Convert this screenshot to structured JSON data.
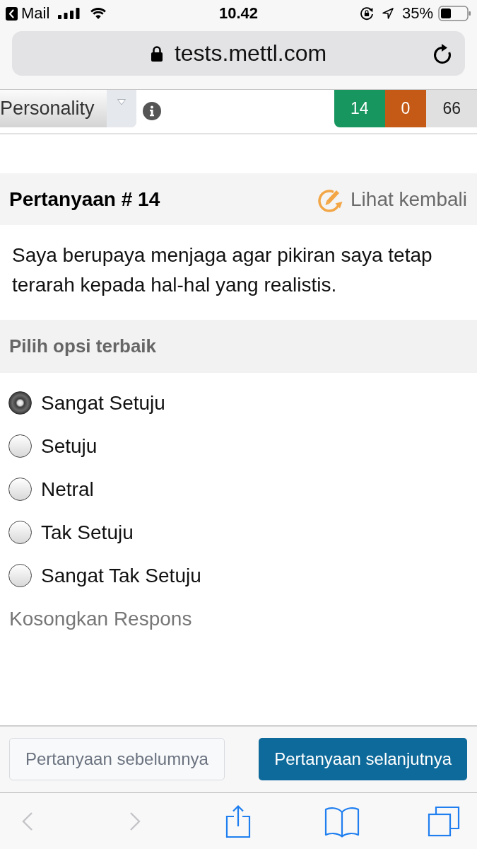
{
  "status_bar": {
    "back_app": "Mail",
    "time": "10.42",
    "battery_percent": "35%"
  },
  "address_bar": {
    "url": "tests.mettl.com"
  },
  "toolbar": {
    "section": "Personality",
    "counters": [
      {
        "value": "14",
        "color": "#17965f"
      },
      {
        "value": "0",
        "color": "#c55a16"
      },
      {
        "value": "66",
        "color": "#e0e0e0"
      }
    ]
  },
  "question": {
    "title": "Pertanyaan # 14",
    "review_link": "Lihat kembali",
    "text": "Saya berupaya menjaga agar pikiran saya tetap terarah kepada hal-hal yang realistis."
  },
  "answers": {
    "heading": "Pilih opsi terbaik",
    "options": [
      {
        "label": "Sangat Setuju",
        "selected": true
      },
      {
        "label": "Setuju",
        "selected": false
      },
      {
        "label": "Netral",
        "selected": false
      },
      {
        "label": "Tak Setuju",
        "selected": false
      },
      {
        "label": "Sangat Tak Setuju",
        "selected": false
      }
    ],
    "clear_link": "Kosongkan Respons"
  },
  "navigation": {
    "previous": "Pertanyaan sebelumnya",
    "next": "Pertanyaan selanjutnya"
  },
  "browser_toolbar": [
    {
      "kind": "back",
      "disabled": true
    },
    {
      "kind": "forward",
      "disabled": true
    },
    {
      "kind": "share",
      "disabled": false
    },
    {
      "kind": "bookmarks",
      "disabled": false
    },
    {
      "kind": "tabs",
      "disabled": false
    }
  ]
}
